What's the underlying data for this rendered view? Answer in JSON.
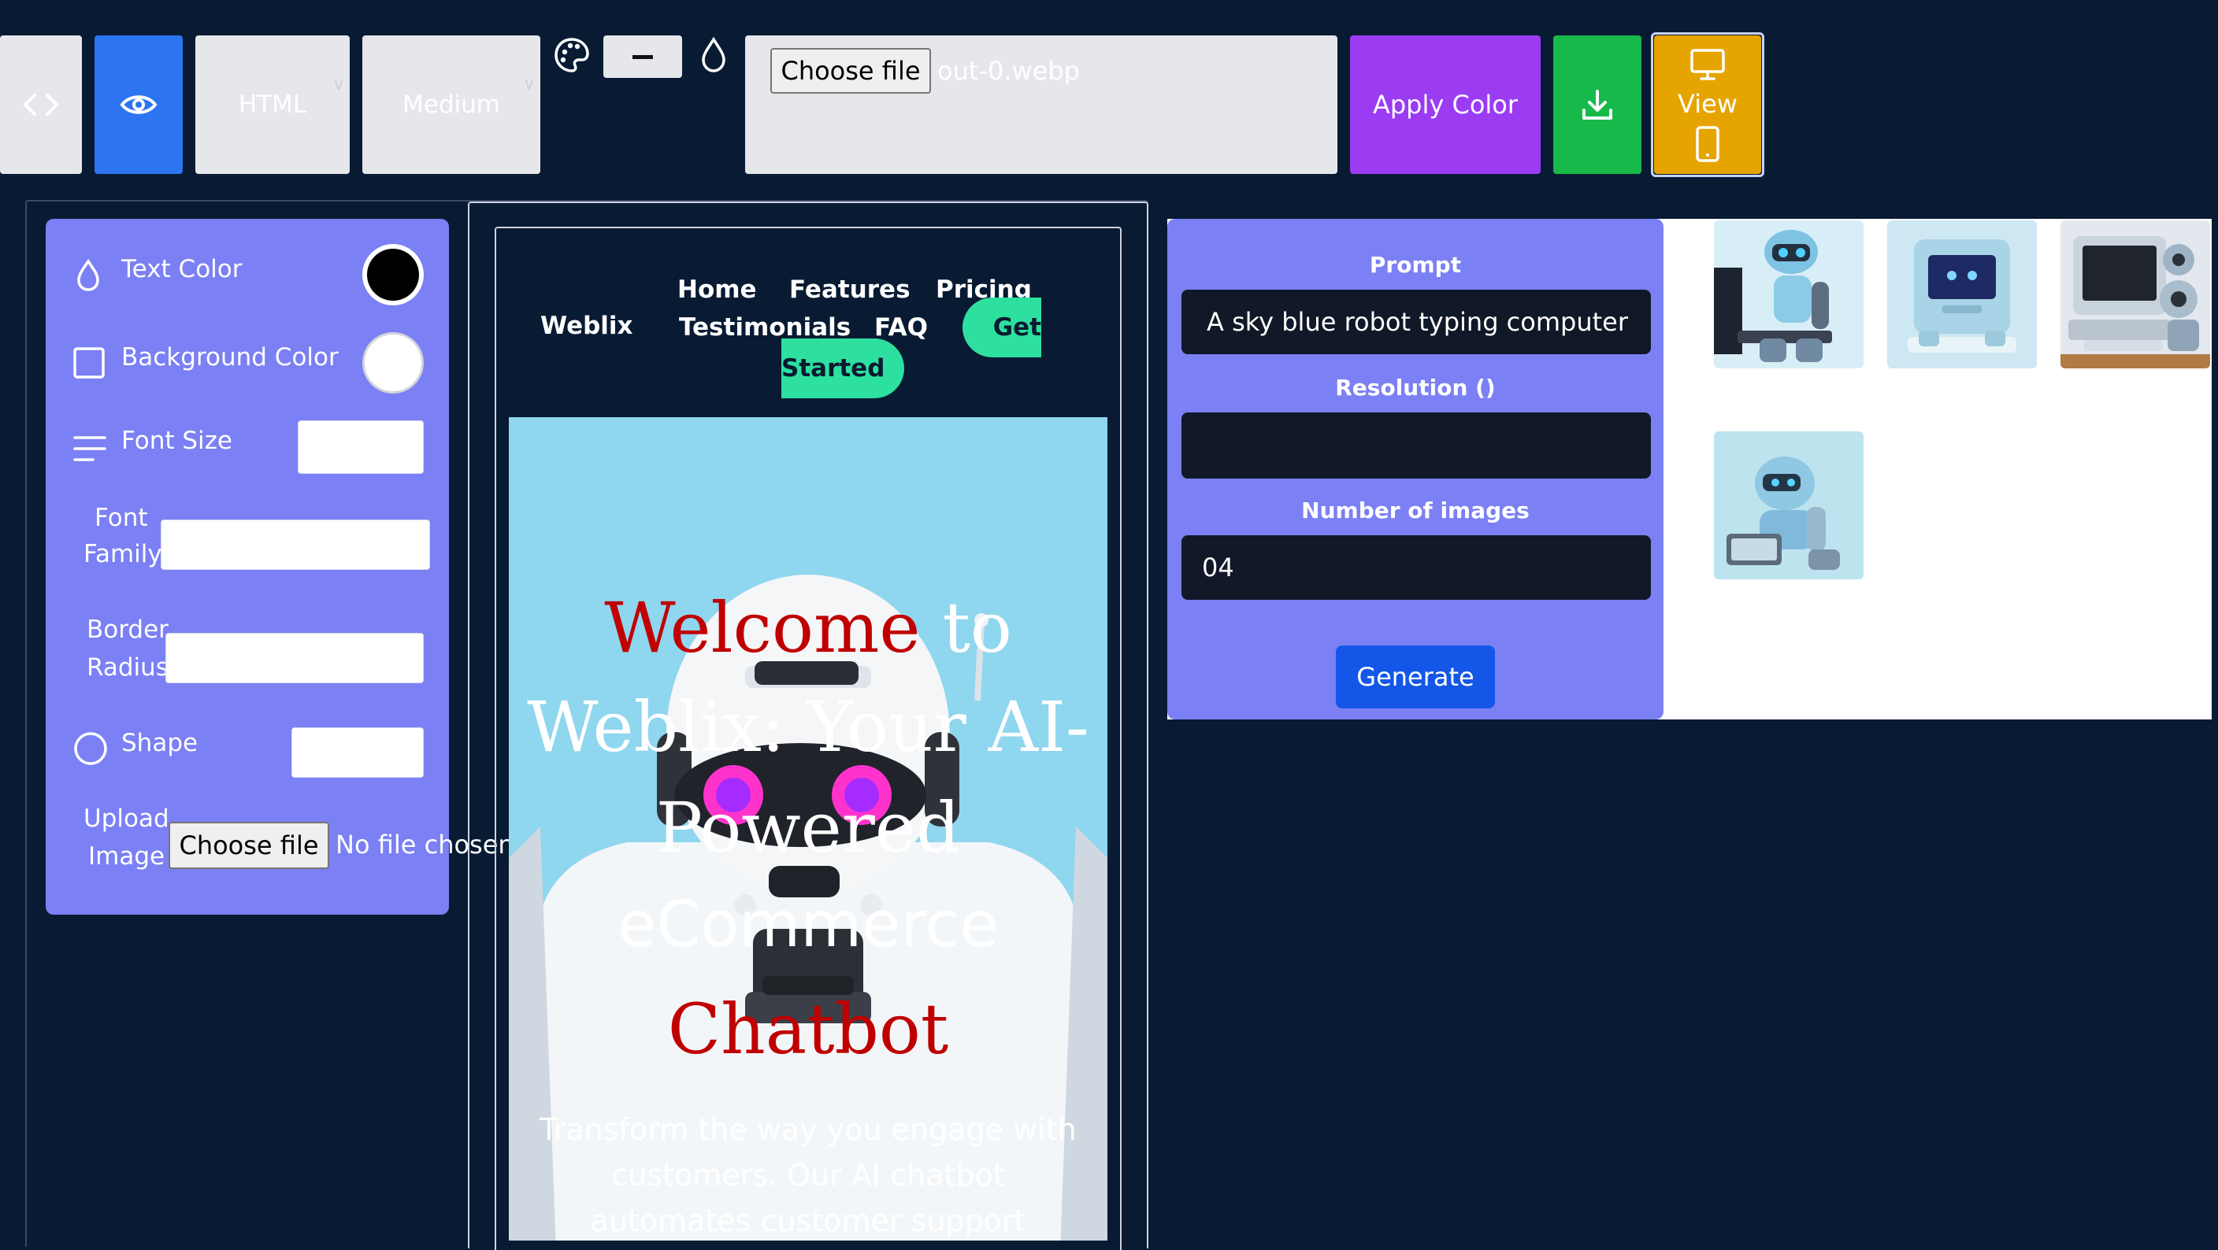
{
  "toolbar": {
    "language": "HTML",
    "size": "Medium",
    "file": {
      "button_label": "Choose file",
      "filename": "out-0.webp"
    },
    "apply_color": "Apply Color",
    "view": "View",
    "colors": {
      "accent_blue": "#2d74f0",
      "purple": "#9b3cf3",
      "green": "#16b94a",
      "amber": "#e6a400"
    }
  },
  "props": {
    "text_color": "Text Color",
    "background_color": "Background Color",
    "font_size": "Font Size",
    "font_family": [
      "Font",
      "Family"
    ],
    "border_radius": [
      "Border",
      "Radius"
    ],
    "shape": "Shape",
    "upload_image": [
      "Upload",
      "Image"
    ],
    "choose_file": "Choose file",
    "no_file": "No file chosen",
    "swatch_text": "#000000",
    "swatch_bg": "#ffffff"
  },
  "preview": {
    "brand": "Weblix",
    "nav": [
      "Home",
      "Features",
      "Pricing",
      "Testimonials",
      "FAQ"
    ],
    "cta_line1": "Get",
    "cta_line2": "Started",
    "hero_title": {
      "line1_a": "Welcome",
      "line1_b": " to",
      "line2": "Weblix: Your AI-",
      "line3": "Powered",
      "line4": "eCommerce",
      "line5": "Chatbot"
    },
    "hero_sub": [
      "Transform the way you engage with",
      "customers. Our AI chatbot",
      "automates customer support"
    ]
  },
  "generator": {
    "prompt_label": "Prompt",
    "prompt_value": "A sky blue robot typing computer",
    "resolution_label": "Resolution ()",
    "resolution_value": "",
    "count_label": "Number of images",
    "count_value": "04",
    "generate": "Generate"
  }
}
